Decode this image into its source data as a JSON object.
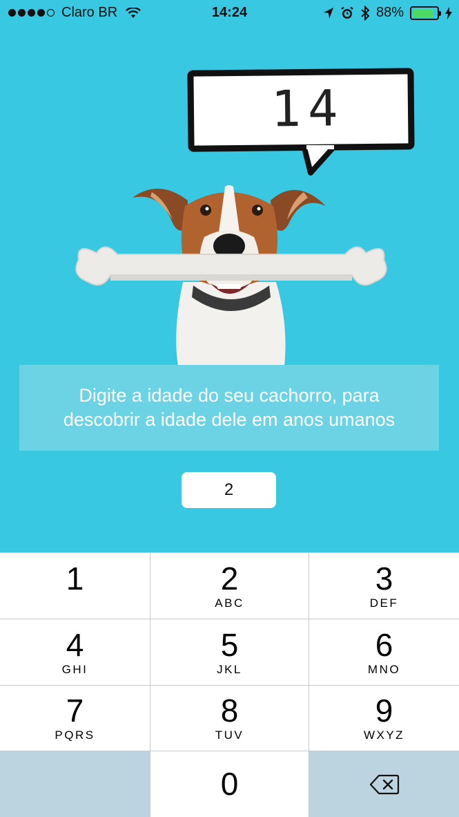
{
  "status_bar": {
    "carrier": "Claro BR",
    "time": "14:24",
    "battery_percent": "88%",
    "battery_level": 0.88
  },
  "bubble": {
    "human_age": "14"
  },
  "info": {
    "message": "Digite a idade do seu cachorro, para descobrir a idade dele em anos umanos"
  },
  "input": {
    "value": "2"
  },
  "keypad": {
    "keys": [
      {
        "num": "1",
        "letters": ""
      },
      {
        "num": "2",
        "letters": "ABC"
      },
      {
        "num": "3",
        "letters": "DEF"
      },
      {
        "num": "4",
        "letters": "GHI"
      },
      {
        "num": "5",
        "letters": "JKL"
      },
      {
        "num": "6",
        "letters": "MNO"
      },
      {
        "num": "7",
        "letters": "PQRS"
      },
      {
        "num": "8",
        "letters": "TUV"
      },
      {
        "num": "9",
        "letters": "WXYZ"
      },
      {
        "num": "0",
        "letters": ""
      }
    ]
  },
  "colors": {
    "background": "#38c8e2",
    "info_box": "#6cd3e4",
    "keypad_special": "#bcd4e0",
    "battery": "#4cd964"
  }
}
